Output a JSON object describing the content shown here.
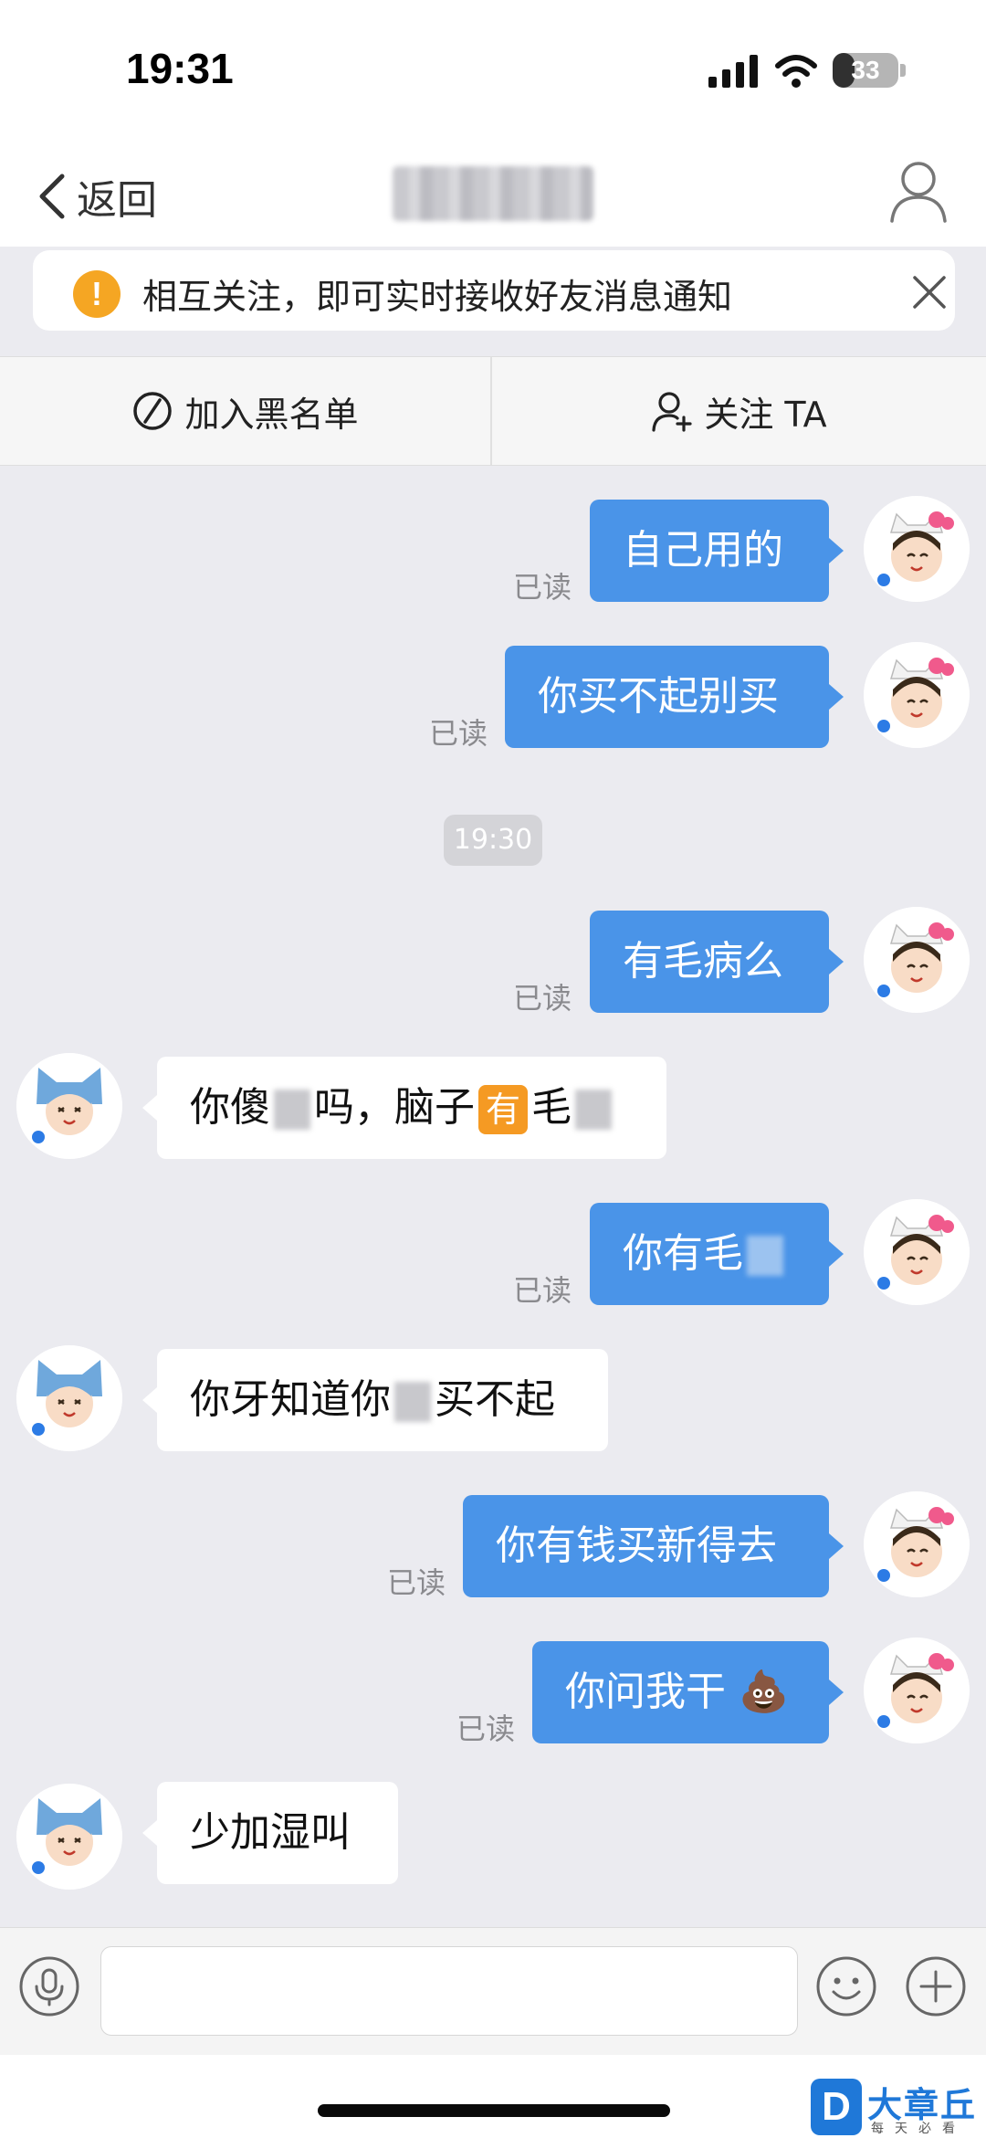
{
  "status_bar": {
    "time": "19:31",
    "battery": "33",
    "battery_level": 0.33
  },
  "nav": {
    "back_label": "返回"
  },
  "notice": {
    "text": "相互关注，即可实时接收好友消息通知"
  },
  "actions": {
    "blacklist_label": "加入黑名单",
    "follow_label": "关注 TA"
  },
  "chat": {
    "read_label": "已读",
    "timestamp": "19:30",
    "messages": [
      {
        "side": "out",
        "text": "自己用的",
        "status": "已读"
      },
      {
        "side": "out",
        "text": "你买不起别买",
        "status": "已读"
      },
      {
        "side": "out",
        "text": "有毛病么",
        "status": "已读"
      },
      {
        "side": "in",
        "text_a": "你傻",
        "text_b": "吗，脑子",
        "emoji": "有",
        "text_c": "毛"
      },
      {
        "side": "out",
        "text_a": "你有毛",
        "status": "已读"
      },
      {
        "side": "in",
        "text_a": "你牙知道你",
        "text_b": "买不起"
      },
      {
        "side": "out",
        "text": "你有钱买新得去",
        "status": "已读"
      },
      {
        "side": "out",
        "text_a": "你问我干",
        "emoji": "💩",
        "status": "已读"
      },
      {
        "side": "in",
        "text": "少加湿叫"
      }
    ]
  },
  "input": {
    "placeholder": ""
  },
  "watermark": {
    "title": "大章丘",
    "subtitle": "每天必看",
    "logo": "D"
  }
}
